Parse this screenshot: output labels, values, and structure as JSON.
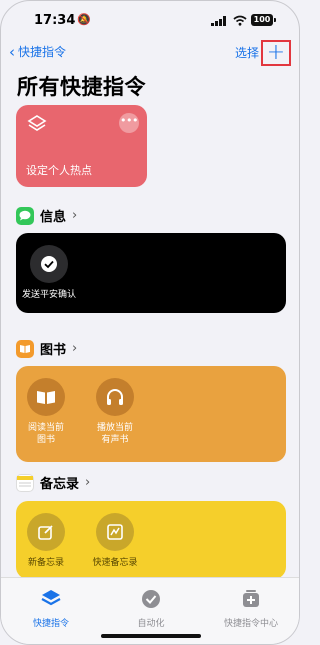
{
  "status_bar": {
    "time": "17:34",
    "battery": "100"
  },
  "nav": {
    "back_label": "快捷指令",
    "select_label": "选择",
    "add_label": "+"
  },
  "page_title": "所有快捷指令",
  "hero_card": {
    "label": "设定个人热点",
    "more_label": "•••",
    "color": "#e8666e"
  },
  "sections": {
    "messages": {
      "title": "信息",
      "color": "#000000",
      "shortcuts": [
        {
          "label": "发送平安确认"
        }
      ]
    },
    "books": {
      "title": "图书",
      "color": "#e9a23f",
      "shortcuts": [
        {
          "label": "阅读当前图书"
        },
        {
          "label": "播放当前有声书"
        }
      ]
    },
    "notes": {
      "title": "备忘录",
      "color": "#f5cf2b",
      "shortcuts": [
        {
          "label": "新备忘录"
        },
        {
          "label": "快速备忘录"
        }
      ]
    }
  },
  "tabs": [
    {
      "label": "快捷指令",
      "icon": "layers-icon",
      "active": true
    },
    {
      "label": "自动化",
      "icon": "check-clock-icon",
      "active": false
    },
    {
      "label": "快捷指令中心",
      "icon": "gallery-plus-icon",
      "active": false
    }
  ],
  "accent_color": "#1a73e8"
}
